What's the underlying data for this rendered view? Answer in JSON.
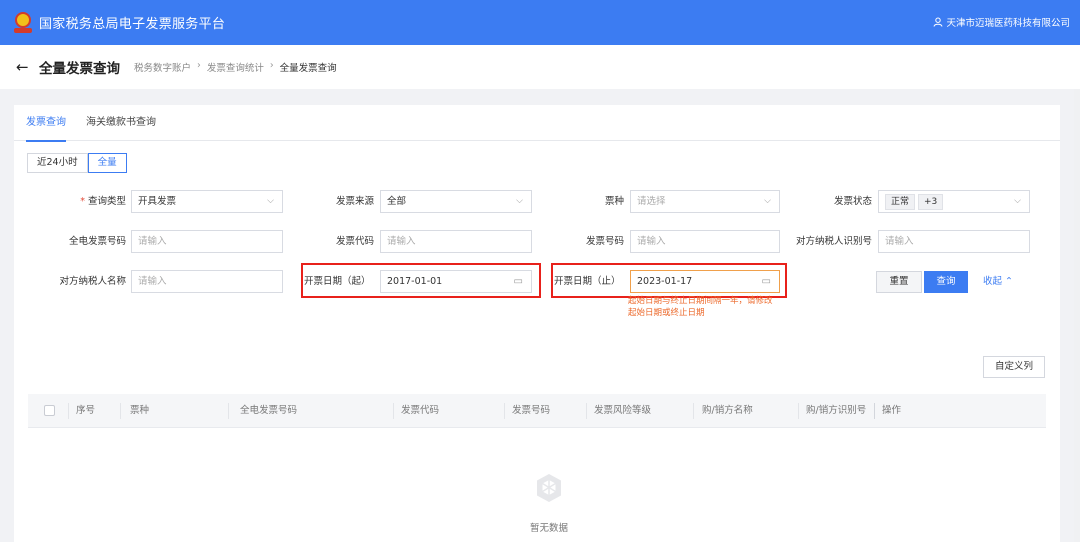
{
  "topbar": {
    "title": "国家税务总局电子发票服务平台",
    "user": "天津市迈瑞医药科技有限公司"
  },
  "header": {
    "title": "全量发票查询",
    "breadcrumb": [
      "税务数字账户",
      "发票查询统计",
      "全量发票查询"
    ]
  },
  "tabs": [
    "发票查询",
    "海关缴款书查询"
  ],
  "range": [
    "近24小时",
    "全量"
  ],
  "form": {
    "query_type": {
      "label": "查询类型",
      "value": "开具发票"
    },
    "source": {
      "label": "发票来源",
      "value": "全部"
    },
    "kind": {
      "label": "票种",
      "placeholder": "请选择"
    },
    "status": {
      "label": "发票状态",
      "tag1": "正常",
      "tag2": "+3"
    },
    "full_no": {
      "label": "全电发票号码",
      "placeholder": "请输入"
    },
    "code": {
      "label": "发票代码",
      "placeholder": "请输入"
    },
    "no": {
      "label": "发票号码",
      "placeholder": "请输入"
    },
    "tax_id": {
      "label": "对方纳税人识别号",
      "placeholder": "请输入"
    },
    "name": {
      "label": "对方纳税人名称",
      "placeholder": "请输入"
    },
    "date_start": {
      "label": "开票日期（起）",
      "value": "2017-01-01"
    },
    "date_end": {
      "label": "开票日期（止）",
      "value": "2023-01-17"
    },
    "hint": "起始日期与终止日期间隔一年，请修改起始日期或终止日期"
  },
  "buttons": {
    "reset": "重置",
    "query": "查询",
    "collapse": "收起",
    "custom_columns": "自定义列"
  },
  "table": {
    "columns": [
      "序号",
      "票种",
      "全电发票号码",
      "发票代码",
      "发票号码",
      "发票风险等级",
      "购/销方名称",
      "购/销方识别号",
      "操作"
    ],
    "empty": "暂无数据"
  }
}
